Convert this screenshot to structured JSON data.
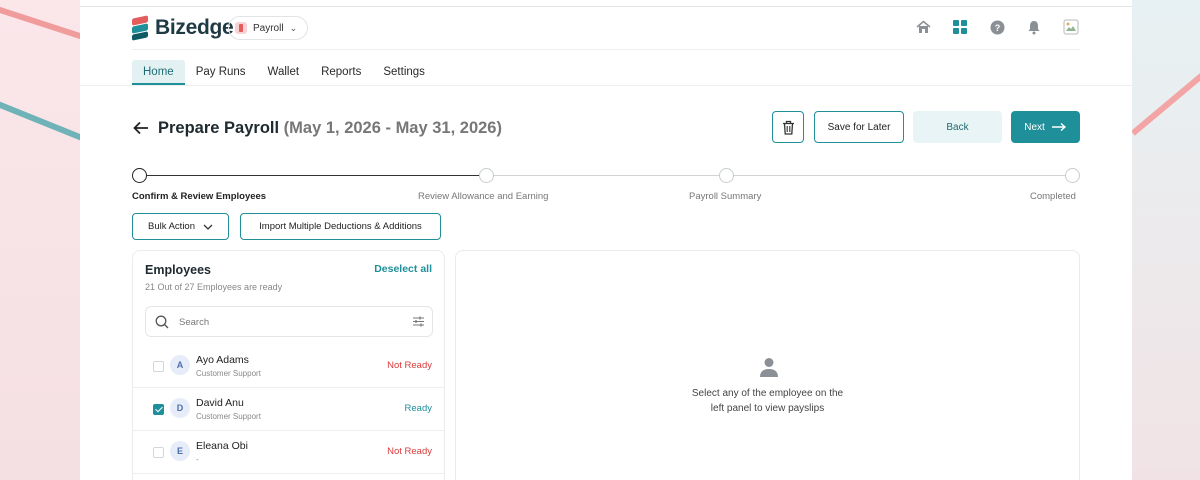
{
  "brand": {
    "name": "Bizedge",
    "product": "Payroll"
  },
  "nav": {
    "tabs": [
      {
        "label": "Home"
      },
      {
        "label": "Pay Runs"
      },
      {
        "label": "Wallet"
      },
      {
        "label": "Reports"
      },
      {
        "label": "Settings"
      }
    ],
    "active": "Home"
  },
  "header_icons": [
    "home-icon",
    "apps-grid-icon",
    "help-icon",
    "bell-icon",
    "profile-avatar"
  ],
  "page": {
    "title": "Prepare Payroll",
    "date_range": "(May 1, 2026 - May 31, 2026)",
    "actions": {
      "save_label": "Save for Later",
      "back_label": "Back",
      "next_label": "Next"
    }
  },
  "stepper": {
    "steps": [
      {
        "label": "Confirm & Review Employees",
        "state": "current"
      },
      {
        "label": "Review Allowance and Earning",
        "state": "pending"
      },
      {
        "label": "Payroll Summary",
        "state": "pending"
      },
      {
        "label": "Completed",
        "state": "pending"
      }
    ]
  },
  "toolbar": {
    "bulk_label": "Bulk Action",
    "import_label": "Import Multiple Deductions & Additions"
  },
  "employees": {
    "title": "Employees",
    "subtitle": "21 Out of 27 Employees are ready",
    "deselect_label": "Deselect all",
    "search_placeholder": "Search",
    "rows": [
      {
        "initial": "A",
        "name": "Ayo Adams",
        "dept": "Customer Support",
        "status": "Not Ready",
        "checked": false
      },
      {
        "initial": "D",
        "name": "David Anu",
        "dept": "Customer Support",
        "status": "Ready",
        "checked": true
      },
      {
        "initial": "E",
        "name": "Eleana Obi",
        "dept": "-",
        "status": "Not Ready",
        "checked": false
      }
    ]
  },
  "payslip": {
    "empty_line1": "Select any of the employee on the",
    "empty_line2": "left panel to view payslips"
  },
  "colors": {
    "accent": "#1f8f9a",
    "danger": "#d93b3b",
    "brand_red": "#e35d5d"
  }
}
